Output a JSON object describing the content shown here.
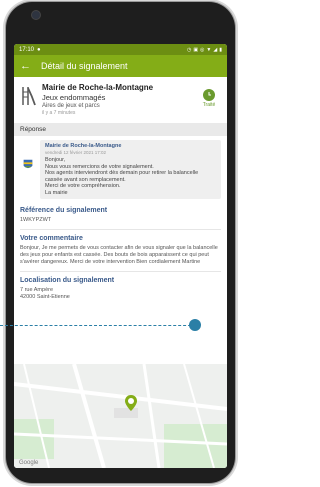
{
  "status_bar": {
    "time": "17:10"
  },
  "app_bar": {
    "title": "Détail du signalement"
  },
  "card": {
    "org": "Mairie de Roche-la-Montagne",
    "issue": "Jeux endommagés",
    "category": "Aires de jeux et parcs",
    "ago": "il y a 7 minutes",
    "status_label": "Traité"
  },
  "reponse": {
    "header": "Réponse",
    "from": "Mairie de Roche-la-Montagne",
    "date": "vendredi 12 février 2021 17:02",
    "lines": [
      "Bonjour,",
      "Nous vous remercions de votre signalement.",
      "Nos agents interviendront dès demain pour retirer la balancelle cassée avant son remplacement.",
      "Merci de votre compréhension.",
      "La mairie"
    ]
  },
  "reference": {
    "label": "Référence du signalement",
    "value": "1WKYPZWT"
  },
  "commentaire": {
    "label": "Votre commentaire",
    "text": "Bonjour, Je me permets de vous contacter afin de vous signaler que la balancelle des jeux pour enfants est cassée. Des bouts de bois apparaissent ce qui peut s'avérer dangereux. Merci de votre intervention Bien cordialement Martine"
  },
  "localisation": {
    "label": "Localisation du signalement",
    "line1": "7 rue Ampère",
    "line2": "42000 Saint-Etienne"
  },
  "map": {
    "attribution": "Google"
  },
  "colors": {
    "status_bar": "#6c8e12",
    "app_bar": "#84ad17",
    "accent_green": "#6a9a2e",
    "link_blue": "#3a5a8a",
    "pin": "#84ad17",
    "callout": "#2b7fa6"
  }
}
